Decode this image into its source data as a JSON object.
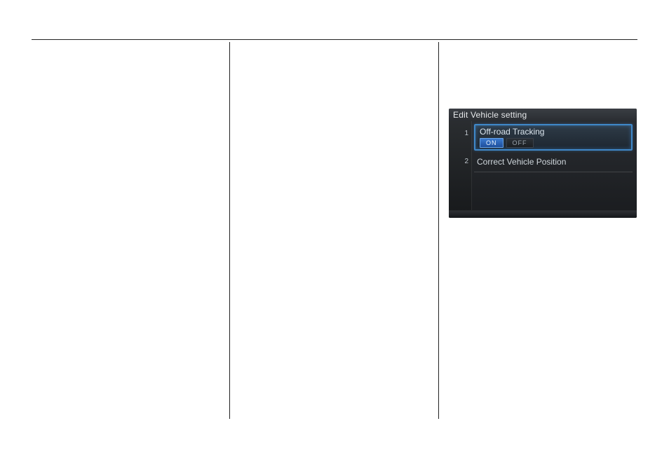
{
  "device": {
    "title": "Edit Vehicle setting",
    "row1": {
      "number": "1",
      "label": "Off-road Tracking",
      "toggle_on": "ON",
      "toggle_off": "OFF"
    },
    "row2": {
      "number": "2",
      "label": "Correct Vehicle Position"
    }
  }
}
